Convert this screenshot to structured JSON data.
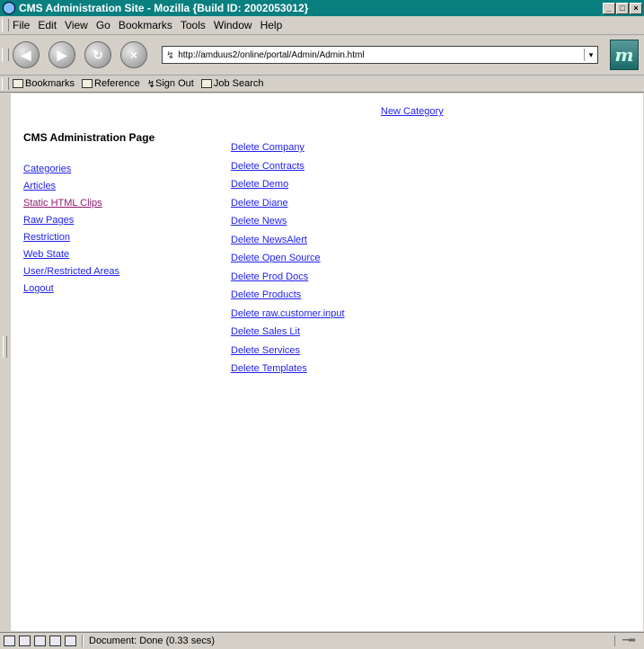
{
  "window": {
    "title": "CMS Administration Site - Mozilla {Build ID: 2002053012}",
    "minimize": "_",
    "maximize": "□",
    "close": "×"
  },
  "menu": {
    "file": "File",
    "edit": "Edit",
    "view": "View",
    "go": "Go",
    "bookmarks": "Bookmarks",
    "tools": "Tools",
    "window": "Window",
    "help": "Help"
  },
  "nav": {
    "url": "http://amduus2/online/portal/Admin/Admin.html",
    "throbber": "m"
  },
  "personal_toolbar": {
    "bookmarks": "Bookmarks",
    "reference": "Reference",
    "signout": "Sign Out",
    "jobsearch": "Job Search"
  },
  "page": {
    "new_category": "New Category",
    "title": "CMS Administration Page",
    "nav_links": {
      "categories": "Categories",
      "articles": "Articles",
      "static_html_clips": "Static HTML Clips",
      "raw_pages": "Raw Pages",
      "restriction": "Restriction",
      "web_state": "Web State",
      "user_restricted_areas": "User/Restricted Areas",
      "logout": "Logout"
    },
    "delete_links": [
      "Delete Company",
      "Delete Contracts",
      "Delete Demo",
      "Delete Diane",
      "Delete News",
      "Delete NewsAlert",
      "Delete Open Source",
      "Delete Prod Docs",
      "Delete Products",
      "Delete raw.customer.input",
      "Delete Sales Lit",
      "Delete Services",
      "Delete Templates"
    ]
  },
  "status": {
    "text": "Document: Done (0.33 secs)"
  },
  "colors": {
    "titlebar": "#0a7f7f",
    "link": "#2222ee",
    "visited_link": "#8b1a6b",
    "chrome": "#d4d0c8"
  }
}
